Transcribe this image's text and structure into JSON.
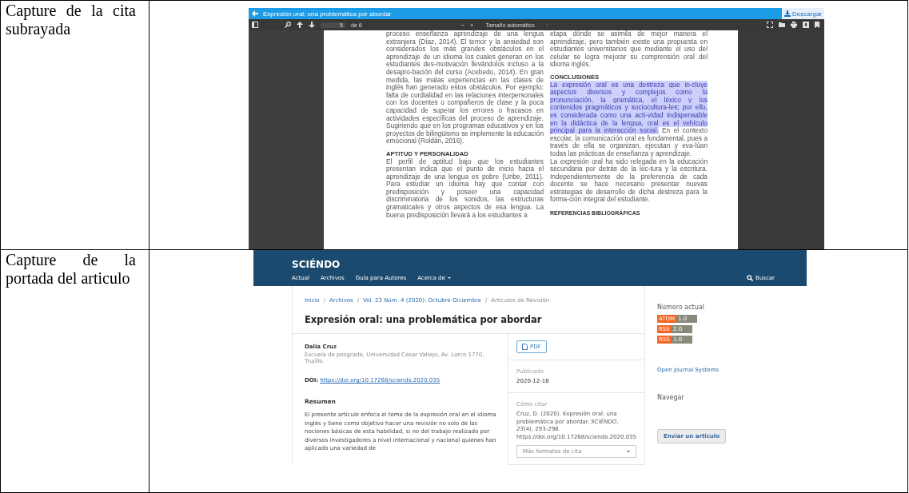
{
  "rows": [
    {
      "label": "Capture de la cita subrayada",
      "screenshot": {
        "kind": "pdf_viewer",
        "title": "Expresión oral: una problemática por abordar",
        "download": "Descargar",
        "page": "5",
        "page_count": "de 6",
        "zoom_out": "−",
        "zoom_in": "+",
        "zoom": "Tamaño automático",
        "zoom_caret": ":",
        "columns": [
          [
            {
              "kind": "paragraph",
              "text": "proceso enseñanza aprendizaje de una lengua extranjera (Díaz, 2014). El temor y la ansiedad son considerados los más grandes obstáculos en el aprendizaje de un idioma los cuales generan en los estudiantes des-motivación llevándolos incluso a la desapro-bación del curso (Acebedo, 2014). En gran medida, las malas experiencias en las clases de inglés han generado estos obstáculos. Por ejemplo: falta de cordialidad en las relaciones interpersonales con los docentes o compañeros de clase y la poca capacidad de superar los errores o fracasos en actividades específicas del proceso de aprendizaje. Sugiriendo que en los programas educativos y en los proyectos de bilingüismo se implemente la educación emocional (Roldán, 2016)."
            },
            {
              "kind": "heading",
              "text": "APTITUD Y PERSONALIDAD"
            },
            {
              "kind": "paragraph",
              "text": "El perfil de aptitud bajo que los estudiantes presentan indica que el punto de inicio hacia el aprendizaje de una lengua es pobre (Uribe, 2011). Para estudiar un idioma hay que contar con predisposición y poseer una capacidad discriminatoria de los sonidos, las estructuras gramaticales y otros aspectos de esa lengua. La buena predisposición llevará a los estudiantes a"
            }
          ],
          [
            {
              "kind": "paragraph",
              "text": "etapa dónde se asimila de mejor manera el aprendizaje, pero también existe una propuesta en estudiantes universitarios que mediante el uso del celular se logra mejorar su comprensión oral del idioma inglés."
            },
            {
              "kind": "heading",
              "text": "CONCLUSIONES"
            },
            {
              "kind": "highlighted_paragraph",
              "highlight": "La expresión oral es una destreza que in-cluye aspectos diversos y complejos como la pronunciación, la gramática, el léxico y los contenidos pragmáticos y sociocultura-les; por ello, es considerada como una acti-vidad indispensable en la didáctica de la lengua, oral es el vehículo principal para la interacción social.",
              "text": " En el contexto escolar, la comunicación oral es fundamental, pues a través de ella se organizan, ejecutan y eva-lúan todas las prácticas de enseñanza y aprendizaje."
            },
            {
              "kind": "paragraph",
              "text": "La expresión oral ha sido relegada en la educación secundaria por detrás de la lec-tura y la escritura. Independientemente de la preferencia de cada docente se hace necesario presentar nuevas estrategias de desarrollo de dicha destreza para la forma-ción integral del estudiante."
            },
            {
              "kind": "small_heading",
              "text": "REFERENCIAS BIBLIOGRÁFICAS"
            }
          ]
        ]
      }
    },
    {
      "label": "Capture de la portada del articulo",
      "screenshot": {
        "kind": "journal_page",
        "brand": "SCIÉNDO",
        "nav": [
          {
            "label": "Actual",
            "dropdown": false
          },
          {
            "label": "Archivos",
            "dropdown": false
          },
          {
            "label": "Guía para Autores",
            "dropdown": false
          },
          {
            "label": "Acerca de",
            "dropdown": true
          }
        ],
        "search": "Buscar",
        "breadcrumb": [
          {
            "label": "Inicio",
            "link": true
          },
          {
            "label": "Archivos",
            "link": true
          },
          {
            "label": "Vol. 23 Núm. 4 (2020): Octubre-Diciembre",
            "link": true
          },
          {
            "label": "Artículos de Revisión",
            "link": false
          }
        ],
        "separator": "/",
        "title": "Expresión oral: una problemática por abordar",
        "author": "Dalia Cruz",
        "affiliation": "Escuela de posgrado, Universidad Cesar Vallejo, Av. Larco 1770, Trujillo.",
        "doi_label": "DOI:",
        "doi": "https://doi.org/10.17268/sciendo.2020.035",
        "abstract_heading": "Resumen",
        "abstract": "El presente artículo enfoca el tema de la expresión oral en el idioma inglés y tiene como objetivo hacer una revisión no solo de las nociones básicas de esta habilidad, si no del trabajo realizado por diversos investigadores a nivel internacional y nacional quienes han aplicado una variedad de",
        "pdf_button": "PDF",
        "published_label": "Publicado",
        "published": "2020-12-18",
        "cite_label": "Cómo citar",
        "citation": "Cruz, D. (2020). Expresión oral: una problemática por abordar. *SCIÉNDO*, *23*(4), 293-298. https://doi.org/10.17268/sciendo.2020.035",
        "cite_formats": {
          "placeholder": "Más formatos de cita"
        },
        "current_issue": "Número actual",
        "feeds": [
          {
            "name": "ATOM",
            "version": "1.0"
          },
          {
            "name": "RSS",
            "version": "2.0"
          },
          {
            "name": "RSS",
            "version": "1.0"
          }
        ],
        "ojs_link": "Open Journal Systems",
        "browse": "Navegar",
        "submit": "Enviar un articulo"
      }
    }
  ]
}
